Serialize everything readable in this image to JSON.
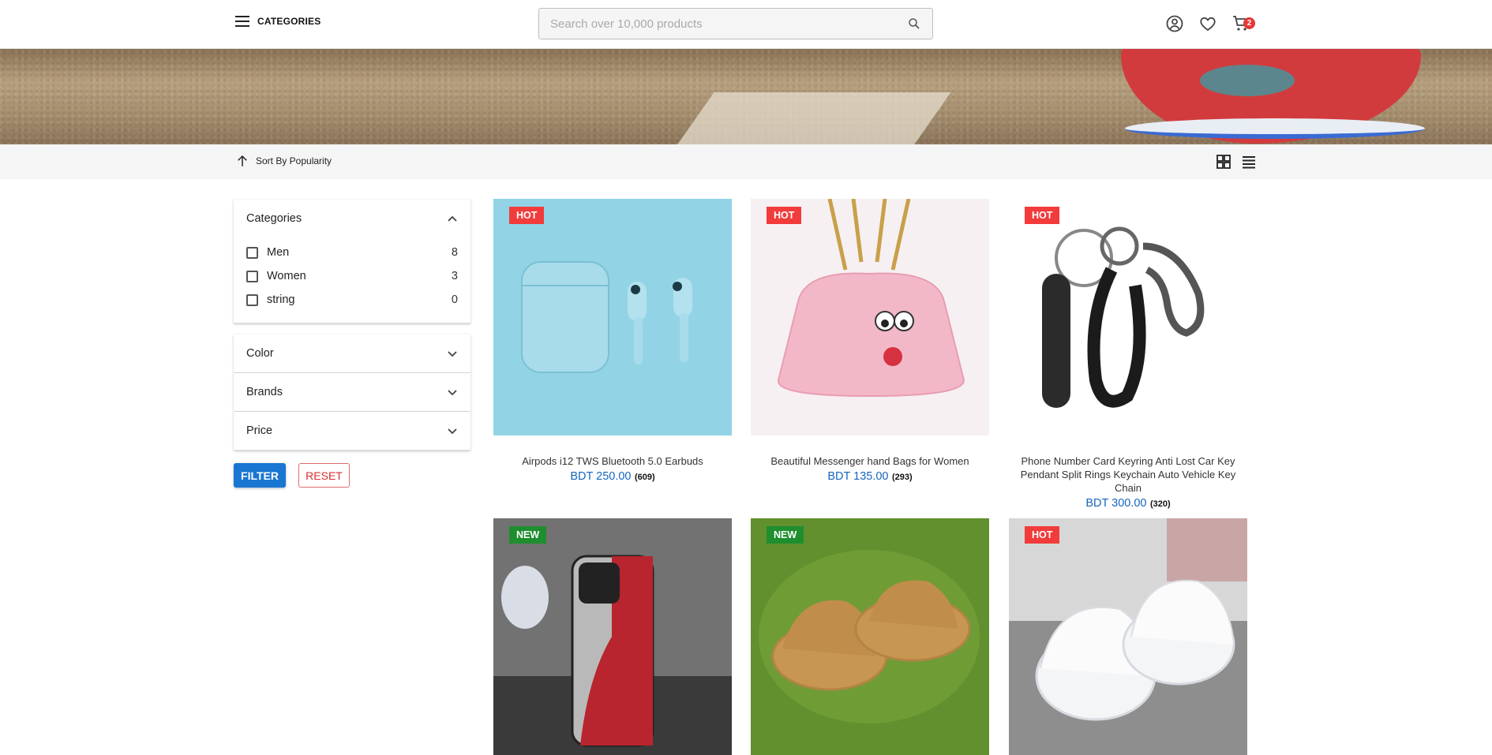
{
  "header": {
    "categories_label": "CATEGORIES",
    "search_placeholder": "Search over 10,000 products",
    "cart_count": "2"
  },
  "toolbar": {
    "sort_label": "Sort By Popularity"
  },
  "filters": {
    "categories": {
      "title": "Categories",
      "items": [
        {
          "label": "Men",
          "count": "8"
        },
        {
          "label": "Women",
          "count": "3"
        },
        {
          "label": "string",
          "count": "0"
        }
      ]
    },
    "color_title": "Color",
    "brands_title": "Brands",
    "price_title": "Price",
    "filter_button": "FILTER",
    "reset_button": "RESET"
  },
  "products": [
    {
      "badge": "HOT",
      "title": "Airpods i12 TWS Bluetooth 5.0 Earbuds",
      "price": "BDT 250.00",
      "reviews": "(609)"
    },
    {
      "badge": "HOT",
      "title": "Beautiful Messenger hand Bags for Women",
      "price": "BDT 135.00",
      "reviews": "(293)"
    },
    {
      "badge": "HOT",
      "title": "Phone Number Card Keyring Anti Lost Car Key Pendant Split Rings Keychain Auto Vehicle Key Chain",
      "price": "BDT 300.00",
      "reviews": "(320)"
    },
    {
      "badge": "NEW"
    },
    {
      "badge": "NEW"
    },
    {
      "badge": "HOT"
    }
  ],
  "colors": {
    "accent_blue": "#1976d2",
    "hot_badge": "#f23b3b",
    "new_badge": "#1e8e2e",
    "price_blue": "#1565c0",
    "cart_badge": "#e53935"
  }
}
